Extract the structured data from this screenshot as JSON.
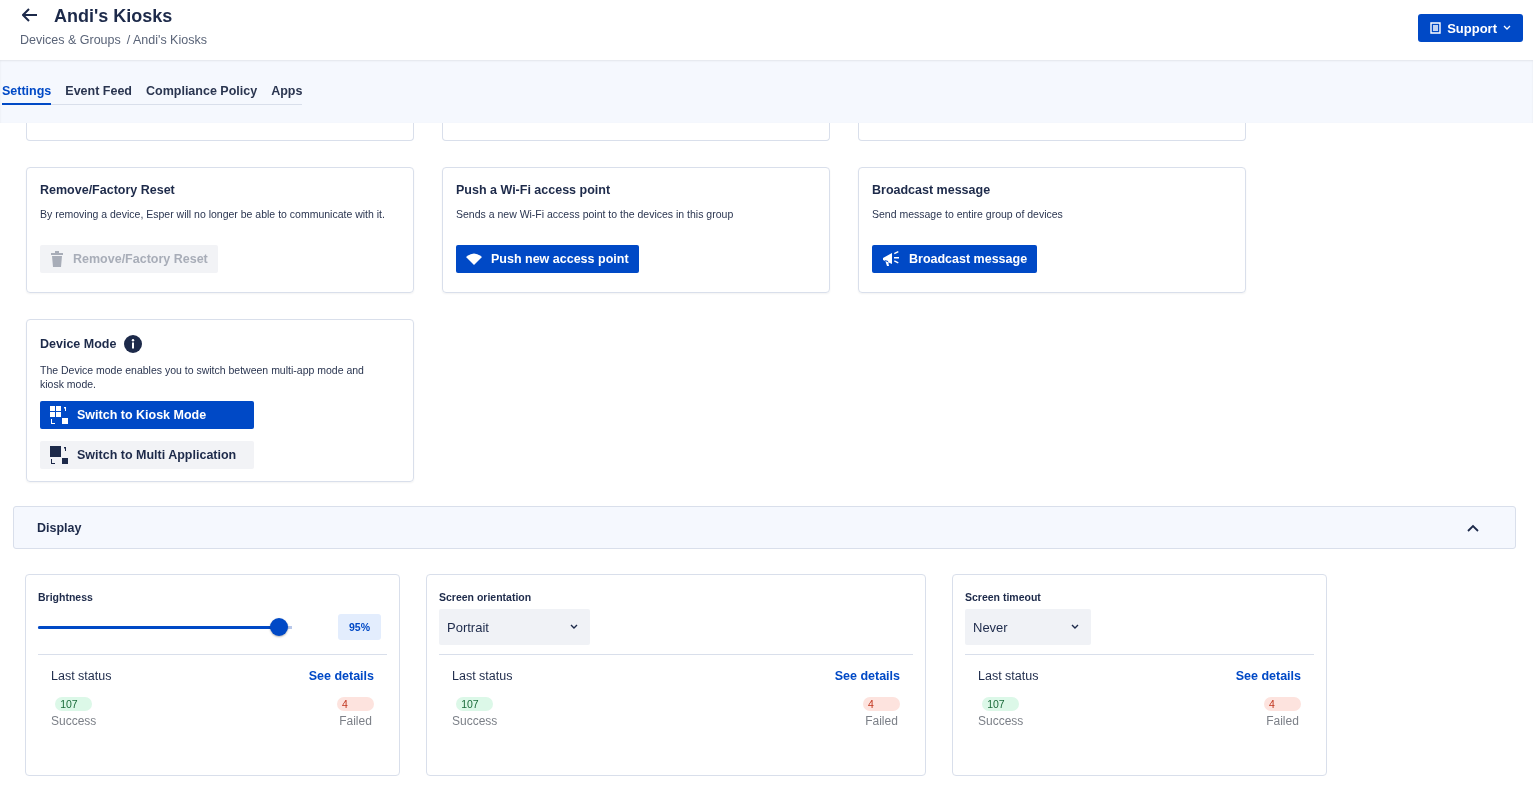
{
  "header": {
    "title": "Andi's Kiosks",
    "breadcrumb": [
      "Devices & Groups",
      "/ Andi's Kiosks"
    ],
    "support_button": "Support"
  },
  "tabs": [
    {
      "label": "Settings",
      "selected": true
    },
    {
      "label": "Event Feed",
      "selected": false
    },
    {
      "label": "Compliance Policy",
      "selected": false
    },
    {
      "label": "Apps",
      "selected": false
    }
  ],
  "action_cards": [
    {
      "title": "Remove/Factory Reset",
      "info": false,
      "description": "By removing a device, Esper will no longer be able to communicate with it.",
      "buttons": [
        {
          "label": "Remove/Factory Reset",
          "kind": "remove",
          "disabled": true
        }
      ]
    },
    {
      "title": "Push a Wi-Fi access point",
      "info": false,
      "description": "Sends a new Wi-Fi access point to the devices in this group",
      "buttons": [
        {
          "label": "Push new access point",
          "kind": "wifi",
          "disabled": false
        }
      ]
    },
    {
      "title": "Broadcast message",
      "info": false,
      "description": "Send message to entire group of devices",
      "buttons": [
        {
          "label": "Broadcast message",
          "kind": "broadcast",
          "disabled": false
        }
      ]
    },
    {
      "title": "Device Mode",
      "info": true,
      "description": "The Device mode enables you to switch between multi-app mode and kiosk mode.",
      "buttons": [
        {
          "label": "Switch to Kiosk Mode",
          "kind": "kiosk",
          "disabled": false
        },
        {
          "label": "Switch to Multi Application",
          "kind": "multi",
          "disabled": false
        }
      ]
    }
  ],
  "display_section": {
    "title": "Display",
    "expanded": true
  },
  "settings": [
    {
      "kind": "slider",
      "label": "Brightness",
      "level": 0.95,
      "reading": "95%",
      "status": {
        "label": "Last status",
        "link": "See details",
        "success_count": "107",
        "success_label": "Success",
        "failed_count": "4",
        "failed_label": "Failed"
      }
    },
    {
      "kind": "select",
      "label": "Screen orientation",
      "value": "Portrait",
      "status": {
        "label": "Last status",
        "link": "See details",
        "success_count": "107",
        "success_label": "Success",
        "failed_count": "4",
        "failed_label": "Failed"
      }
    },
    {
      "kind": "select",
      "label": "Screen timeout",
      "value": "Never",
      "status": {
        "label": "Last status",
        "link": "See details",
        "success_count": "107",
        "success_label": "Success",
        "failed_count": "4",
        "failed_label": "Failed"
      }
    }
  ]
}
